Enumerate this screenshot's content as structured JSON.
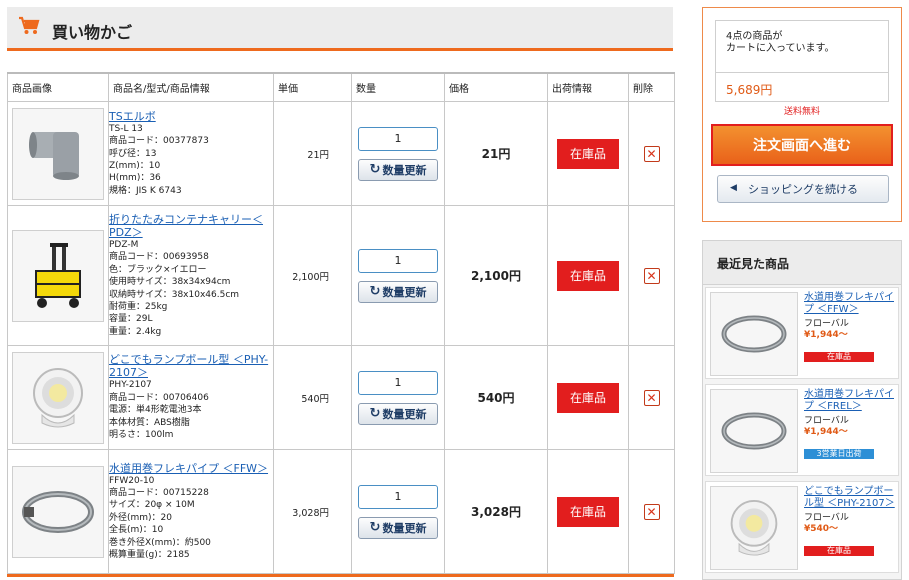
{
  "header": {
    "title": "買い物かご",
    "cart_icon": "shopping-cart-icon"
  },
  "columns": [
    "商品画像",
    "商品名/型式/商品情報",
    "単価",
    "数量",
    "価格",
    "出荷情報",
    "削除"
  ],
  "update_label": "数量更新",
  "items": [
    {
      "name": "TSエルボ",
      "lines": [
        "TS-L 13",
        "商品コード：00377873",
        "呼び径：13",
        "Z(mm)：10",
        "H(mm)：36",
        "規格：JIS K 6743"
      ],
      "unit_price": "21円",
      "qty": "1",
      "price": "21円",
      "stock": "在庫品"
    },
    {
      "name": "折りたたみコンテナキャリー＜PDZ＞",
      "lines": [
        "PDZ-M",
        "商品コード：00693958",
        "色：ブラック×イエロー",
        "使用時サイズ：38x34x94cm",
        "収納時サイズ：38x10x46.5cm",
        "耐荷重：25kg",
        "容量：29L",
        "重量：2.4kg"
      ],
      "unit_price": "2,100円",
      "qty": "1",
      "price": "2,100円",
      "stock": "在庫品"
    },
    {
      "name": "どこでもランプボール型 ＜PHY-2107＞",
      "lines": [
        "PHY-2107",
        "商品コード：00706406",
        "電源：単4形乾電池3本",
        "本体材質：ABS樹脂",
        "明るさ：100lm"
      ],
      "unit_price": "540円",
      "qty": "1",
      "price": "540円",
      "stock": "在庫品"
    },
    {
      "name": "水道用巻フレキパイプ ＜FFW＞",
      "lines": [
        "FFW20-10",
        "商品コード：00715228",
        "サイズ：20φ × 10M",
        "外径(mm)：20",
        "全長(m)：10",
        "巻き外径X(mm)：約500",
        "概算重量(g)：2185"
      ],
      "unit_price": "3,028円",
      "qty": "1",
      "price": "3,028円",
      "stock": "在庫品"
    }
  ],
  "summary": {
    "message_line1": "4点の商品が",
    "message_line2": "カートに入っています。",
    "total": "5,689円",
    "shipping": "送料無料",
    "order_button": "注文画面へ進む",
    "continue_button": "ショッピングを続ける"
  },
  "recent": {
    "title": "最近見た商品",
    "items": [
      {
        "name": "水道用巻フレキパイプ ＜FFW＞",
        "maker": "フローバル",
        "price": "¥1,944～",
        "badge": "在庫品",
        "badge_color": "#e21e1e"
      },
      {
        "name": "水道用巻フレキパイプ ＜FREL＞",
        "maker": "フローバル",
        "price": "¥1,944～",
        "badge": "3営業日出荷",
        "badge_color": "#2d8fd6"
      },
      {
        "name": "どこでもランプボール型 ＜PHY-2107＞",
        "maker": "フローバル",
        "price": "¥540～",
        "badge": "在庫品",
        "badge_color": "#e21e1e"
      }
    ]
  },
  "colors": {
    "accent": "#ee6a1e",
    "stock_red": "#e21e1e",
    "link": "#1a5fb4",
    "price_orange": "#e05a16"
  }
}
